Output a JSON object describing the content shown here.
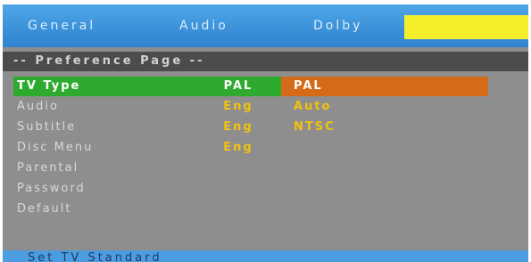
{
  "tabs": [
    {
      "label": "General"
    },
    {
      "label": "Audio"
    },
    {
      "label": "Dolby"
    },
    {
      "label": ""
    }
  ],
  "page_title": "-- Preference Page --",
  "menu_items": [
    {
      "label": "TV Type",
      "value": "PAL"
    },
    {
      "label": "Audio",
      "value": "Eng"
    },
    {
      "label": "Subtitle",
      "value": "Eng"
    },
    {
      "label": "Disc Menu",
      "value": "Eng"
    },
    {
      "label": "Parental",
      "value": ""
    },
    {
      "label": "Password",
      "value": ""
    },
    {
      "label": "Default",
      "value": ""
    }
  ],
  "options": [
    "PAL",
    "Auto",
    "NTSC"
  ],
  "status": "Set TV Standard",
  "colors": {
    "tab_bar": "#3a94dc",
    "active_tab": "#f4ee2a",
    "selected_row": "#2eab2e",
    "highlighted_option": "#d56a18",
    "value_text": "#f2c20f",
    "background": "#8e8e8e"
  }
}
